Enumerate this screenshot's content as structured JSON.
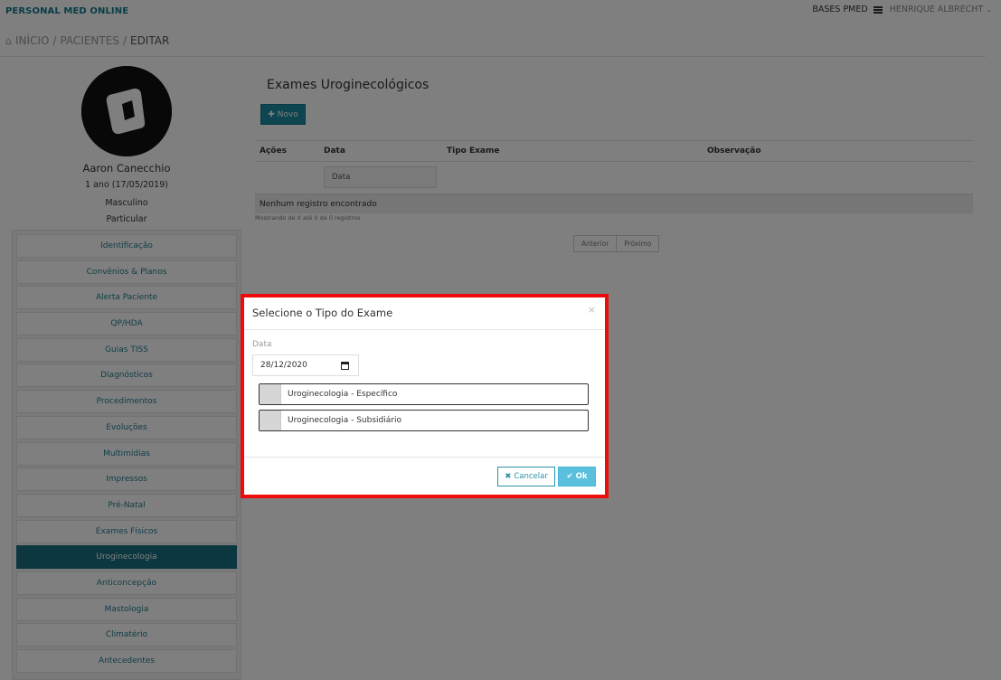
{
  "header": {
    "brand": "PERSONAL MED ONLINE",
    "bases": "BASES PMED",
    "user": "HENRIQUE ALBRECHT"
  },
  "breadcrumb": [
    "INÍCIO",
    "PACIENTES",
    "EDITAR"
  ],
  "patient": {
    "name": "Aaron Canecchio",
    "age": "1 ano (17/05/2019)",
    "sex": "Masculino",
    "plan": "Particular"
  },
  "sidebar": {
    "items": [
      {
        "label": "Identificação",
        "active": false
      },
      {
        "label": "Convênios & Planos",
        "active": false
      },
      {
        "label": "Alerta Paciente",
        "active": false
      },
      {
        "label": "QP/HDA",
        "active": false
      },
      {
        "label": "Guias TISS",
        "active": false
      },
      {
        "label": "Diagnósticos",
        "active": false
      },
      {
        "label": "Procedimentos",
        "active": false
      },
      {
        "label": "Evoluções",
        "active": false
      },
      {
        "label": "Multimídias",
        "active": false
      },
      {
        "label": "Impressos",
        "active": false
      },
      {
        "label": "Pré-Natal",
        "active": false
      },
      {
        "label": "Exames Físicos",
        "active": false
      },
      {
        "label": "Uroginecologia",
        "active": true
      },
      {
        "label": "Anticoncepção",
        "active": false
      },
      {
        "label": "Mastologia",
        "active": false
      },
      {
        "label": "Climatério",
        "active": false
      },
      {
        "label": "Antecedentes",
        "active": false
      }
    ]
  },
  "main": {
    "title": "Exames Uroginecológicos",
    "new_button": "Novo",
    "table": {
      "headers": [
        "Ações",
        "Data",
        "Tipo Exame",
        "Observação"
      ],
      "filter_placeholder": "Data",
      "empty_message": "Nenhum registro encontrado",
      "showing": "Mostrando de 0 até 0 de 0 registros"
    },
    "pagination": {
      "prev": "Anterior",
      "next": "Próximo"
    }
  },
  "modal": {
    "title": "Selecione o Tipo do Exame",
    "close": "×",
    "date_label": "Data",
    "date_value": "28/12/2020",
    "options": [
      "Uroginecologia - Específico",
      "Uroginecologia - Subsidiário"
    ],
    "cancel_label": "Cancelar",
    "ok_label": "Ok"
  },
  "colors": {
    "brand": "#137a8e",
    "primary": "#1a8ba2",
    "sidebar_active": "#1a6f80",
    "ok_button": "#5bc0de",
    "highlight": "#ee0b0b"
  }
}
